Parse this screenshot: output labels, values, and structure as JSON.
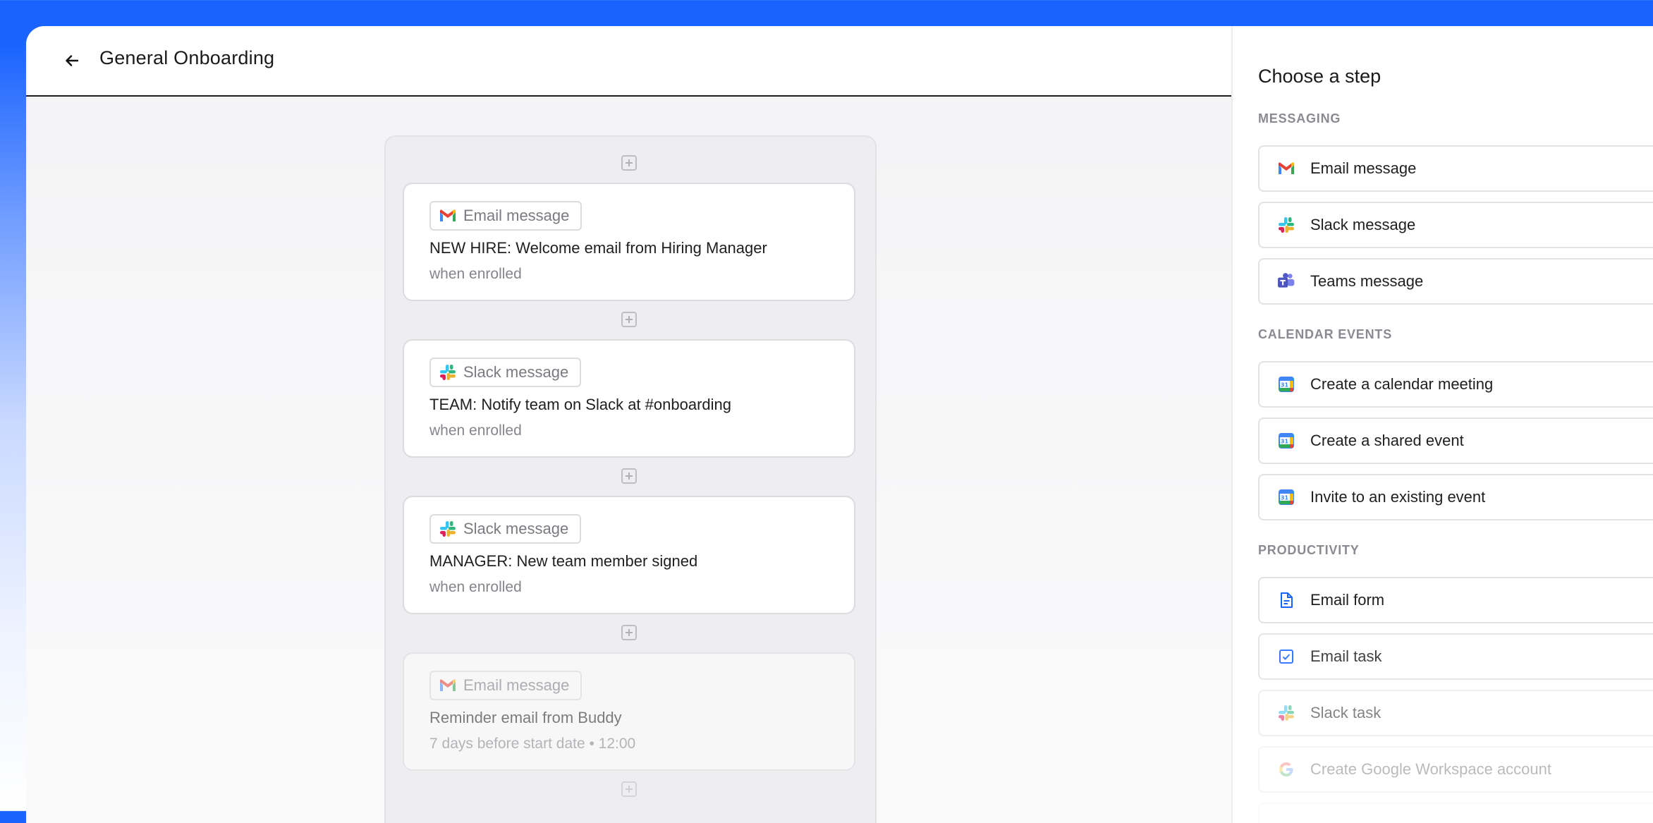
{
  "header": {
    "back_label": "←",
    "title": "General Onboarding"
  },
  "flow": {
    "cards": [
      {
        "type": "Email message",
        "icon": "gmail-icon",
        "title": "NEW HIRE: Welcome email from Hiring Manager",
        "timing": "when enrolled"
      },
      {
        "type": "Slack message",
        "icon": "slack-icon",
        "title": "TEAM: Notify team on Slack at #onboarding",
        "timing": "when enrolled"
      },
      {
        "type": "Slack message",
        "icon": "slack-icon",
        "title": "MANAGER: New team member signed",
        "timing": "when enrolled"
      },
      {
        "type": "Email message",
        "icon": "gmail-icon",
        "title": "Reminder email from Buddy",
        "timing": "7 days before start date  •  12:00"
      }
    ]
  },
  "panel": {
    "title": "Choose a step",
    "sections": [
      {
        "label": "MESSAGING",
        "items": [
          {
            "label": "Email message",
            "icon": "gmail-icon"
          },
          {
            "label": "Slack message",
            "icon": "slack-icon"
          },
          {
            "label": "Teams message",
            "icon": "teams-icon"
          }
        ]
      },
      {
        "label": "CALENDAR EVENTS",
        "items": [
          {
            "label": "Create a calendar meeting",
            "icon": "google-calendar-icon"
          },
          {
            "label": "Create a shared event",
            "icon": "google-calendar-icon"
          },
          {
            "label": "Invite to an existing event",
            "icon": "google-calendar-icon"
          }
        ]
      },
      {
        "label": "PRODUCTIVITY",
        "items": [
          {
            "label": "Email form",
            "icon": "form-document-icon"
          },
          {
            "label": "Email task",
            "icon": "task-checkbox-icon"
          },
          {
            "label": "Slack task",
            "icon": "slack-icon"
          },
          {
            "label": "Create Google Workspace account",
            "icon": "google-icon"
          }
        ]
      }
    ]
  },
  "colors": {
    "brand_blue": "#1a63ff",
    "card_border": "#dcdce0",
    "panel_border": "#e2e2e6"
  }
}
